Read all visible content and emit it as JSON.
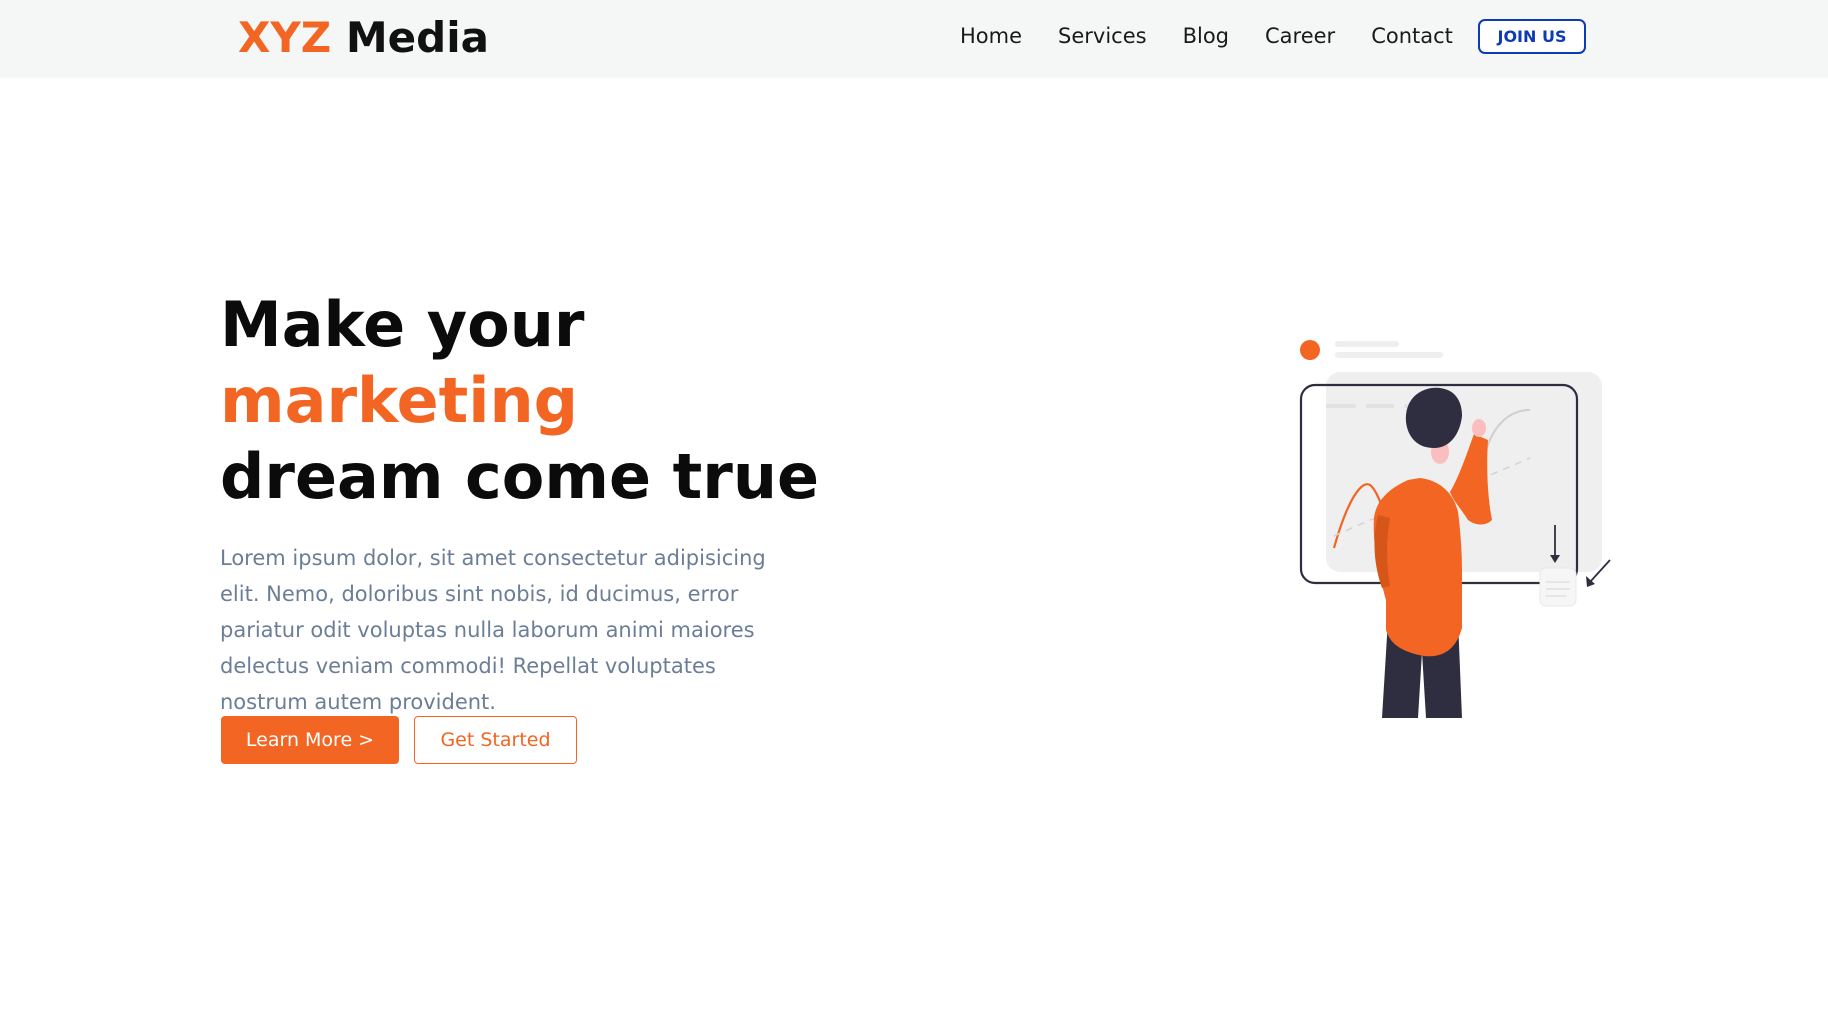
{
  "header": {
    "logo_part1": "XYZ",
    "logo_part2": " Media",
    "nav": [
      "Home",
      "Services",
      "Blog",
      "Career",
      "Contact"
    ],
    "join_label": "JOIN US"
  },
  "hero": {
    "title_line1": "Make your",
    "title_line2": "marketing",
    "title_line3": "dream come true",
    "description": "Lorem ipsum dolor, sit amet consectetur adipisicing elit. Nemo, doloribus sint nobis, id ducimus, error pariatur odit voluptas nulla laborum animi maiores delectus veniam commodi! Repellat voluptates nostrum autem provident.",
    "primary_button": "Learn More >",
    "secondary_button": "Get Started"
  },
  "illustration": {
    "icon": "person-at-chart-board-illustration"
  },
  "colors": {
    "accent": "#f26522",
    "join_button": "#0d3ab5",
    "nav_background": "#f5f7f7",
    "body_text": "#6b7e96"
  }
}
